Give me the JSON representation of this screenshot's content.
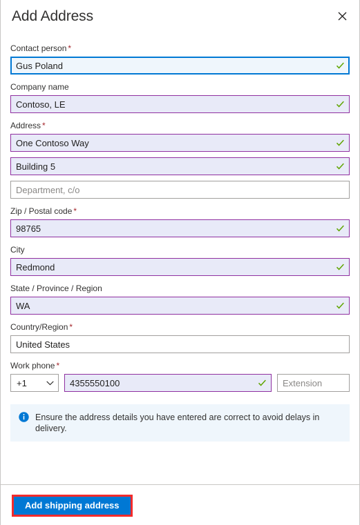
{
  "panel": {
    "title": "Add Address",
    "close_icon": "close-icon"
  },
  "form": {
    "fields": [
      {
        "id": "contact-person",
        "label": "Contact person",
        "required": true,
        "value": "Gus Poland",
        "placeholder": "",
        "state": "focus",
        "valid": true
      },
      {
        "id": "company-name",
        "label": "Company name",
        "required": false,
        "value": "Contoso, LE",
        "placeholder": "",
        "state": "valid",
        "valid": true
      },
      {
        "id": "address-line-1",
        "label": "Address",
        "required": true,
        "value": "One Contoso Way",
        "placeholder": "",
        "state": "valid",
        "valid": true
      },
      {
        "id": "address-line-2",
        "label": "",
        "required": false,
        "value": "Building 5",
        "placeholder": "",
        "state": "valid",
        "valid": true
      },
      {
        "id": "address-line-3",
        "label": "",
        "required": false,
        "value": "",
        "placeholder": "Department, c/o",
        "state": "plain",
        "valid": false
      },
      {
        "id": "zip-postal-code",
        "label": "Zip / Postal code",
        "required": true,
        "value": "98765",
        "placeholder": "",
        "state": "valid",
        "valid": true
      },
      {
        "id": "city",
        "label": "City",
        "required": false,
        "value": "Redmond",
        "placeholder": "",
        "state": "valid",
        "valid": true
      },
      {
        "id": "state-province-region",
        "label": "State / Province / Region",
        "required": false,
        "value": "WA",
        "placeholder": "",
        "state": "valid",
        "valid": true
      },
      {
        "id": "country-region",
        "label": "Country/Region",
        "required": true,
        "value": "United States",
        "placeholder": "",
        "state": "plain",
        "valid": false
      }
    ],
    "phone": {
      "label": "Work phone",
      "required": true,
      "country_code": "+1",
      "country_code_icon": "chevron-down-icon",
      "number": "4355550100",
      "number_valid": true,
      "extension_placeholder": "Extension",
      "extension_value": ""
    }
  },
  "info": {
    "icon": "info-circle-icon",
    "text": "Ensure the address details you have entered are correct to avoid delays in delivery."
  },
  "footer": {
    "submit_label": "Add shipping address"
  },
  "colors": {
    "accent_blue": "#0078d4",
    "validated_purple": "#8f2fa0",
    "validated_fill": "#e8eaf8",
    "focus_fill": "#eff6fc",
    "check_green": "#5fa500",
    "required_red": "#a4262c",
    "highlight_red": "#f32b2b",
    "info_bg": "#eff6fc"
  }
}
